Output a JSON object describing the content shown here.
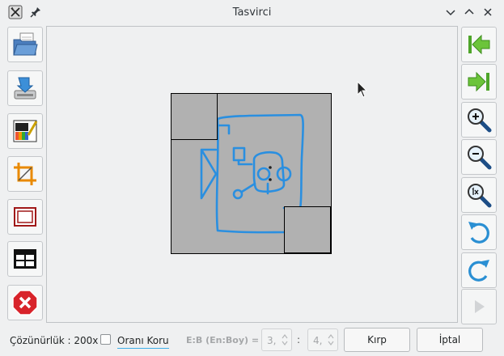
{
  "window": {
    "title": "Tasvirci",
    "app_icon": "app-icon",
    "pin_icon": "pin-icon",
    "controls": [
      "minimize-icon",
      "maximize-icon",
      "close-icon"
    ]
  },
  "left_toolbar": [
    {
      "name": "open-file-button",
      "icon": "folder-open-icon"
    },
    {
      "name": "save-button",
      "icon": "save-icon"
    },
    {
      "name": "color-adjust-button",
      "icon": "color-palette-icon"
    },
    {
      "name": "crop-button",
      "icon": "crop-icon"
    },
    {
      "name": "frame-button",
      "icon": "frame-icon"
    },
    {
      "name": "grid-button",
      "icon": "grid-icon"
    },
    {
      "name": "cancel-button",
      "icon": "stop-icon"
    }
  ],
  "right_toolbar": [
    {
      "name": "first-button",
      "icon": "go-first-icon"
    },
    {
      "name": "last-button",
      "icon": "go-last-icon"
    },
    {
      "name": "zoom-in-button",
      "icon": "zoom-in-icon"
    },
    {
      "name": "zoom-out-button",
      "icon": "zoom-out-icon"
    },
    {
      "name": "zoom-original-button",
      "icon": "zoom-original-icon"
    },
    {
      "name": "rotate-left-button",
      "icon": "rotate-left-icon"
    },
    {
      "name": "rotate-right-button",
      "icon": "rotate-right-icon"
    },
    {
      "name": "play-button",
      "icon": "play-icon",
      "enabled": false
    }
  ],
  "bottom": {
    "resolution_label": "Çözünürlük : 200x",
    "keep_ratio_checked": false,
    "keep_ratio_label": "Oranı Koru",
    "ratio_label": "E:B (En:Boy) =",
    "ratio_width": "3,",
    "ratio_colon": ":",
    "ratio_height": "4,",
    "crop_button": "Kırp",
    "cancel_button": "İptal"
  },
  "colors": {
    "accent": "#3daee9",
    "sketch_stroke": "#2a8fe0",
    "image_bg": "#b1b1b1"
  }
}
